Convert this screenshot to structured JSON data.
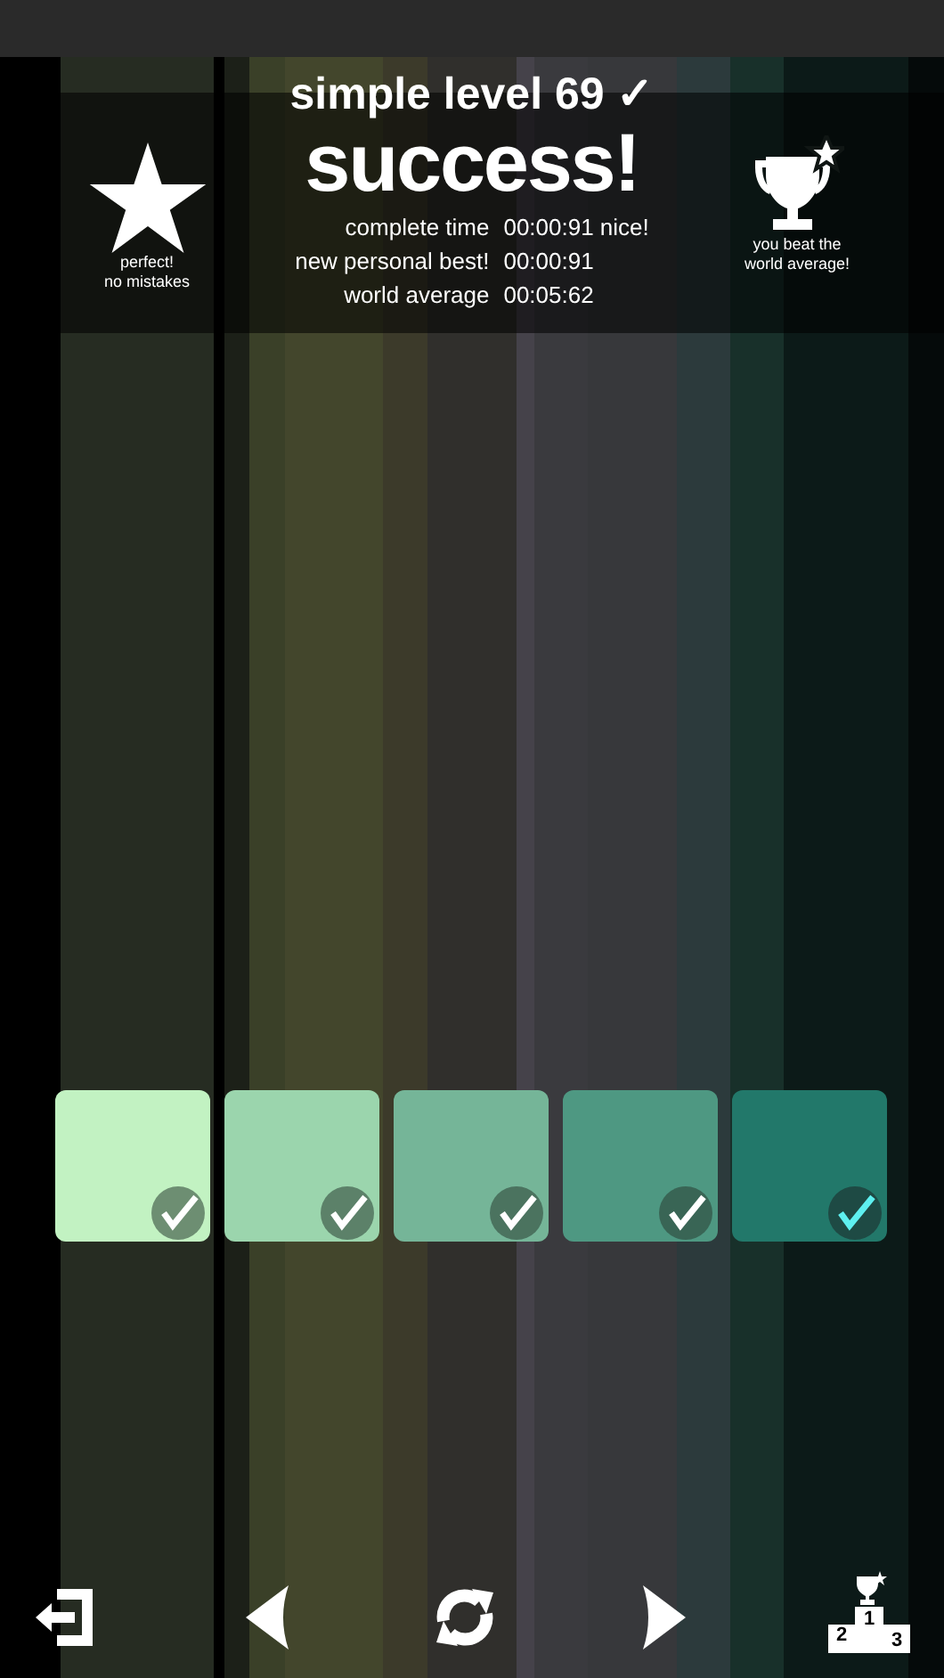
{
  "header": {
    "title": "simple level 69 ✓",
    "headline": "success!",
    "left_badge": {
      "lines": [
        "perfect!",
        "no mistakes"
      ]
    },
    "right_badge": {
      "lines": [
        "you beat the",
        "world average!"
      ]
    },
    "stats": [
      {
        "label": "complete time",
        "value": "00:00:91 nice!"
      },
      {
        "label": "new personal best!",
        "value": "00:00:91"
      },
      {
        "label": "world average",
        "value": "00:05:62"
      }
    ]
  },
  "tiles": [
    {
      "color": "#c2f2c2",
      "checked": true,
      "selected": false
    },
    {
      "color": "#9bd5ad",
      "checked": true,
      "selected": false
    },
    {
      "color": "#75b598",
      "checked": true,
      "selected": false
    },
    {
      "color": "#4e9882",
      "checked": true,
      "selected": false
    },
    {
      "color": "#22786a",
      "checked": true,
      "selected": true
    }
  ],
  "toolbar": [
    {
      "kind": "exit"
    },
    {
      "kind": "previous"
    },
    {
      "kind": "restart"
    },
    {
      "kind": "next"
    },
    {
      "kind": "leaderboard",
      "places": [
        "1",
        "2",
        "3"
      ]
    }
  ]
}
